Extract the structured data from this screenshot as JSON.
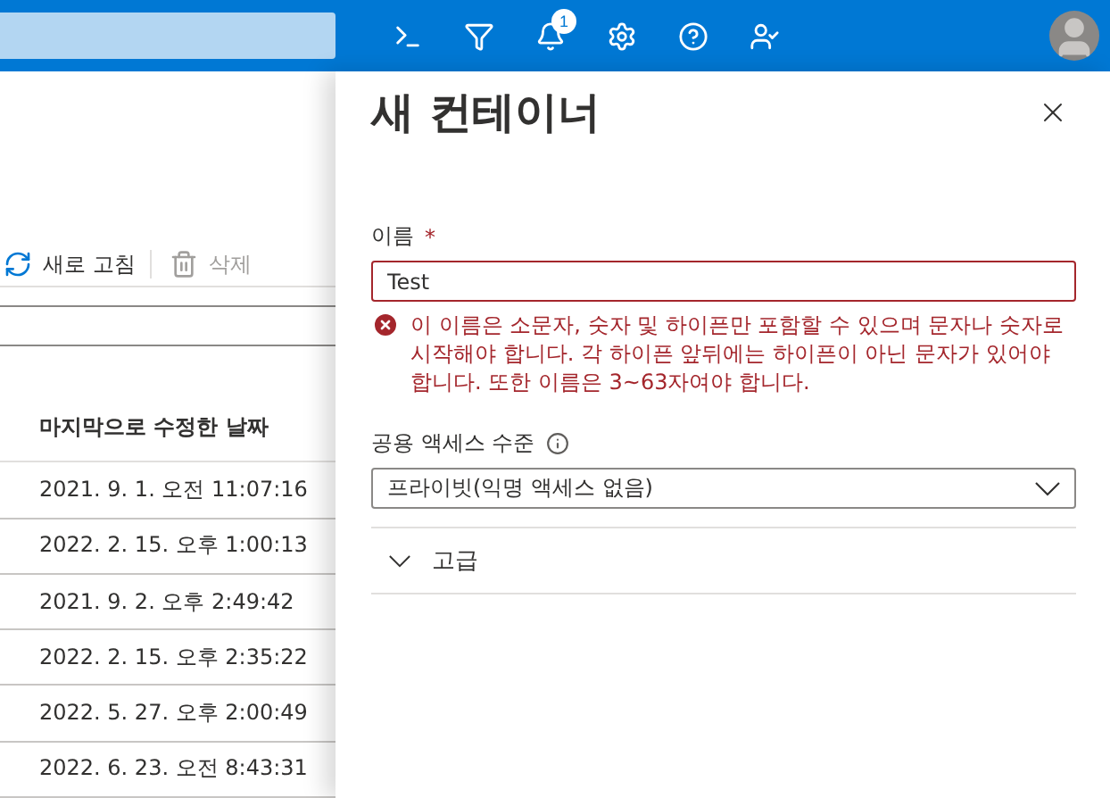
{
  "top_bar": {
    "notification_count": "1"
  },
  "toolbar": [
    {
      "label": "새로 고침",
      "kind": "refresh",
      "disabled": false
    },
    {
      "label": "삭제",
      "kind": "delete",
      "disabled": true
    }
  ],
  "table": {
    "columns": [
      "마지막으로 수정한 날짜"
    ],
    "rows": [
      "2021. 9. 1. 오전 11:07:16",
      "2022. 2. 15. 오후 1:00:13",
      "2021. 9. 2. 오후 2:49:42",
      "2022. 2. 15. 오후 2:35:22",
      "2022. 5. 27. 오후 2:00:49",
      "2022. 6. 23. 오전 8:43:31"
    ]
  },
  "panel": {
    "title": "새 컨테이너",
    "name_field": {
      "label": "이름",
      "required_mark": "*",
      "value": "Test",
      "invalid": true,
      "error": "이 이름은 소문자, 숫자 및 하이픈만 포함할 수 있으며 문자나 숫자로 시작해야 합니다. 각 하이픈 앞뒤에는 하이픈이 아닌 문자가 있어야 합니다. 또한 이름은 3~63자여야 합니다."
    },
    "access_field": {
      "label": "공용 액세스 수준",
      "value": "프라이빗(익명 액세스 없음)"
    },
    "advanced": {
      "label": "고급",
      "expanded": false
    }
  }
}
